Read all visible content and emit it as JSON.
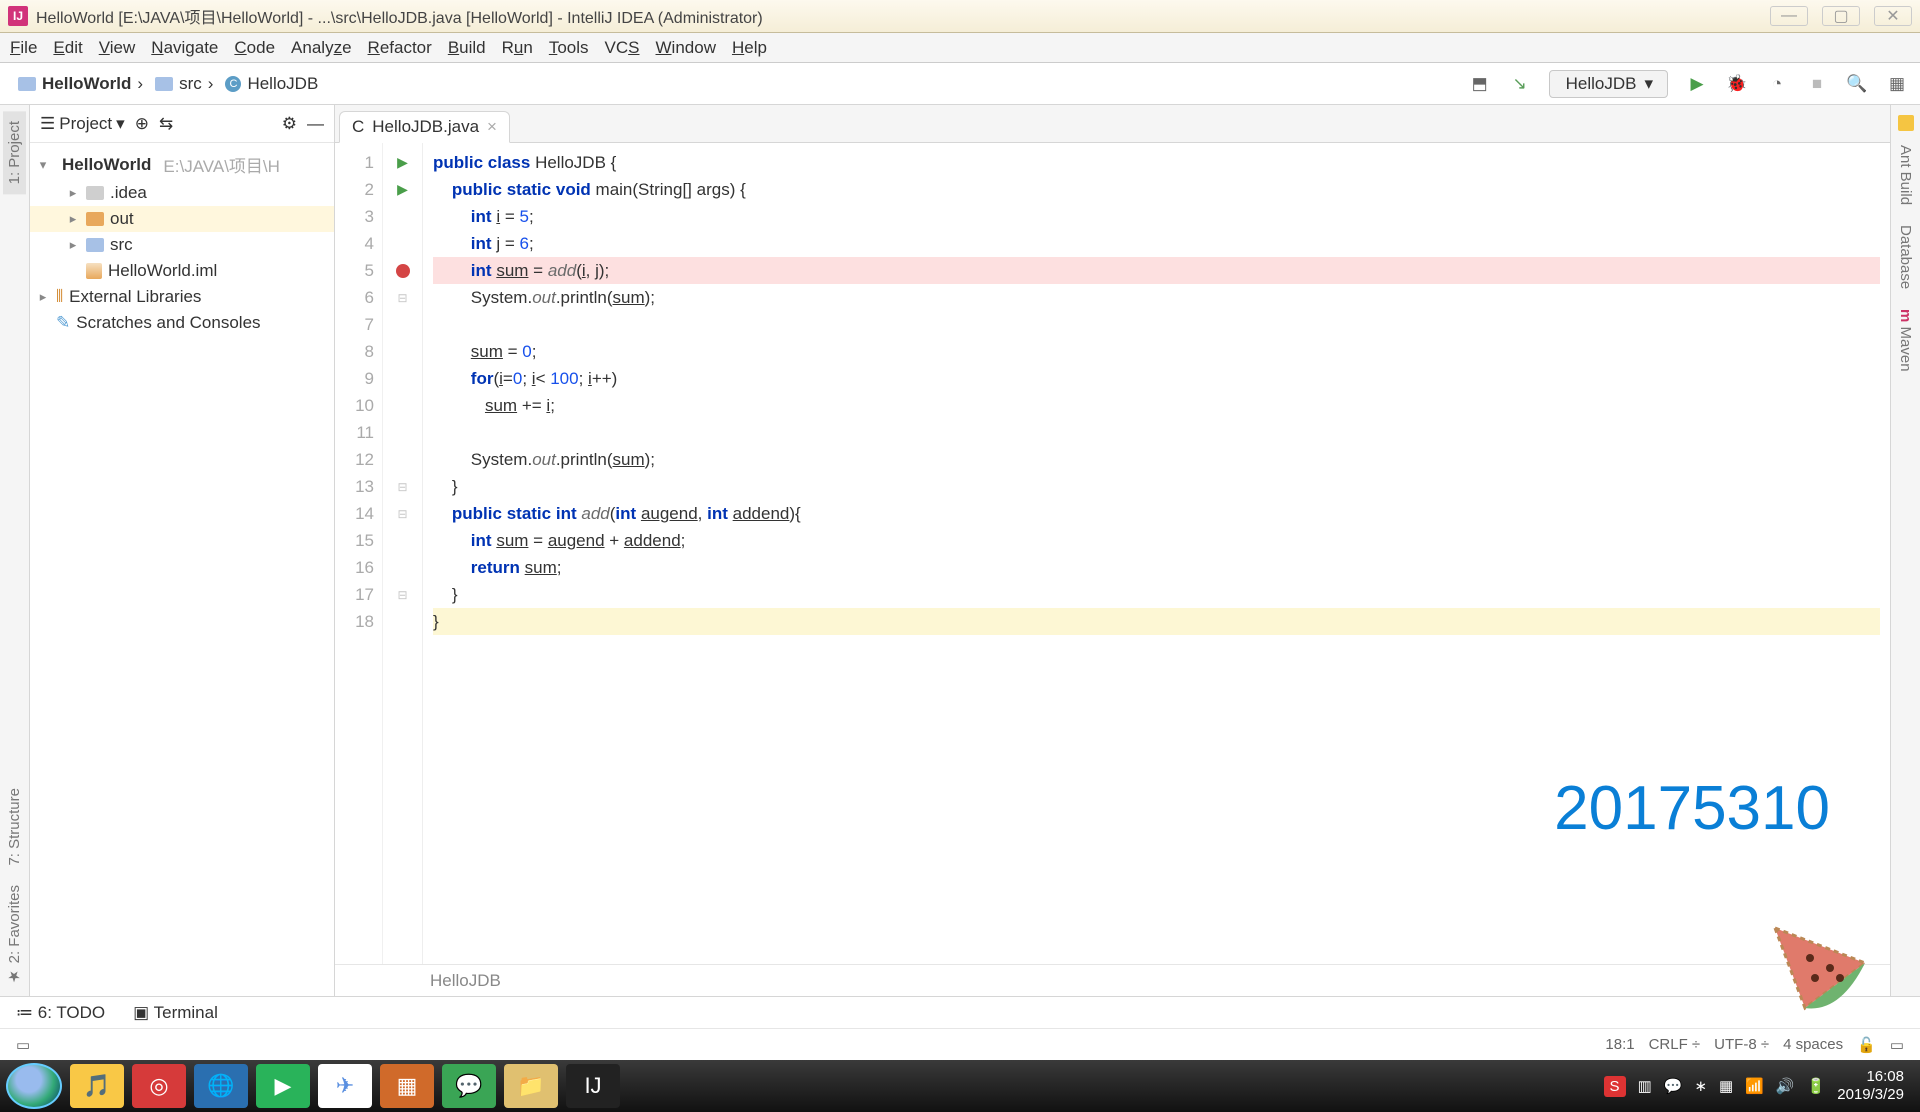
{
  "title": "HelloWorld [E:\\JAVA\\项目\\HelloWorld] - ...\\src\\HelloJDB.java [HelloWorld] - IntelliJ IDEA (Administrator)",
  "menu": [
    "File",
    "Edit",
    "View",
    "Navigate",
    "Code",
    "Analyze",
    "Refactor",
    "Build",
    "Run",
    "Tools",
    "VCS",
    "Window",
    "Help"
  ],
  "breadcrumb": {
    "root": "HelloWorld",
    "dir": "src",
    "file": "HelloJDB"
  },
  "run_config": "HelloJDB",
  "left_tabs": {
    "project": "1: Project",
    "structure": "7: Structure",
    "favorites": "2: Favorites"
  },
  "right_tabs": {
    "ant": "Ant Build",
    "db": "Database",
    "maven": "Maven"
  },
  "project_panel": {
    "title": "Project",
    "root": {
      "name": "HelloWorld",
      "path": "E:\\JAVA\\项目\\H"
    },
    "children": [
      {
        "name": ".idea",
        "type": "dir"
      },
      {
        "name": "out",
        "type": "dir-orange",
        "selected": true
      },
      {
        "name": "src",
        "type": "dir-blue"
      },
      {
        "name": "HelloWorld.iml",
        "type": "iml"
      }
    ],
    "external": "External Libraries",
    "scratches": "Scratches and Consoles"
  },
  "editor_tab": "HelloJDB.java",
  "code_lines": [
    "public class HelloJDB {",
    "    public static void main(String[] args) {",
    "        int i = 5;",
    "        int j = 6;",
    "        int sum = add(i, j);",
    "        System.out.println(sum);",
    "",
    "        sum = 0;",
    "        for(i=0; i< 100; i++)",
    "           sum += i;",
    "",
    "        System.out.println(sum);",
    "    }",
    "    public static int add(int augend, int addend){",
    "        int sum = augend + addend;",
    "        return sum;",
    "    }",
    "}"
  ],
  "breakpoint_line": 5,
  "run_markers": [
    1,
    2
  ],
  "editor_breadcrumb": "HelloJDB",
  "watermark": "20175310",
  "bottom_tabs": {
    "todo": "6: TODO",
    "terminal": "Terminal"
  },
  "status": {
    "pos": "18:1",
    "sep": "CRLF",
    "enc": "UTF-8",
    "indent": "4 spaces"
  },
  "tray": {
    "time": "16:08",
    "date": "2019/3/29"
  }
}
